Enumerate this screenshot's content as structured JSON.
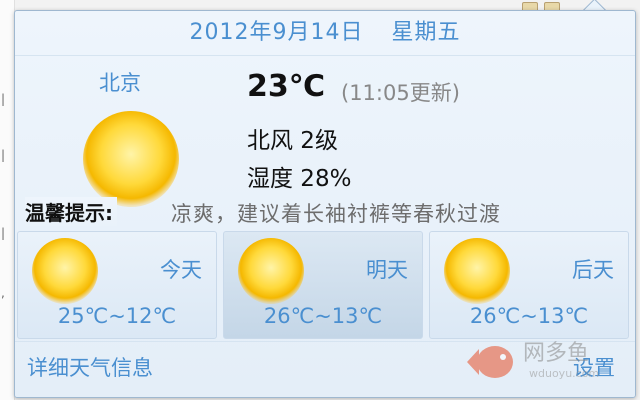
{
  "header": {
    "date": "2012年9月14日",
    "weekday": "星期五"
  },
  "current": {
    "city": "北京",
    "icon": "sunny-icon",
    "temperature": "23℃",
    "update_time": "(11:05更新)",
    "wind": "北风 2级",
    "humidity": "湿度 28%"
  },
  "tip": {
    "label": "温馨提示:",
    "text": "凉爽，建议着长袖衬裤等春秋过渡"
  },
  "forecast": [
    {
      "name": "今天",
      "temp": "25℃~12℃",
      "icon": "sunny-icon"
    },
    {
      "name": "明天",
      "temp": "26℃~13℃",
      "icon": "sunny-icon"
    },
    {
      "name": "后天",
      "temp": "26℃~13℃",
      "icon": "sunny-icon"
    }
  ],
  "footer": {
    "details": "详细天气信息",
    "settings": "设置"
  },
  "watermark": {
    "brand": "网多鱼",
    "domain": "wduoyu.com"
  },
  "colors": {
    "accent": "#4a8fd0",
    "panel_bg": "#eaf3fb",
    "border": "#9fb8d0"
  }
}
